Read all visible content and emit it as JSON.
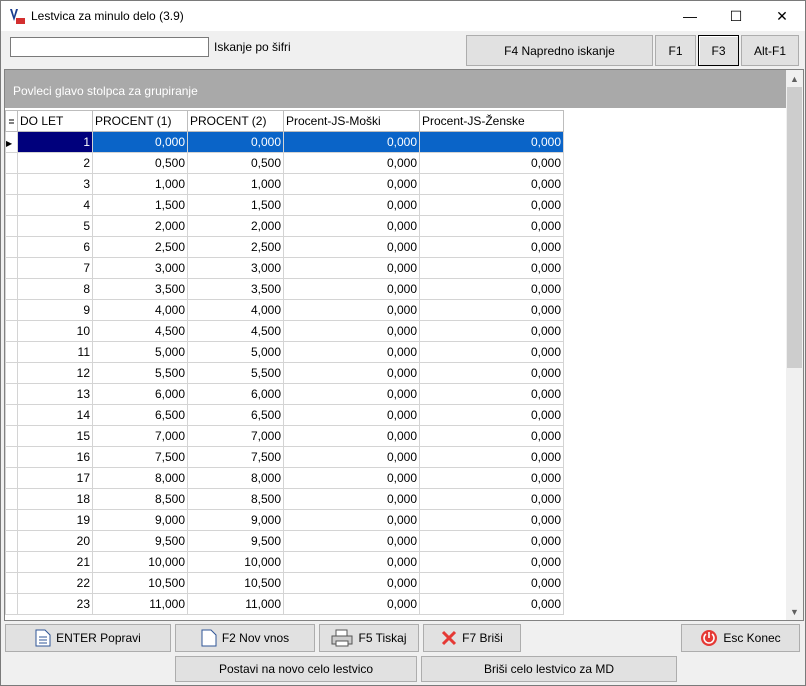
{
  "window": {
    "title": "Lestvica za minulo delo  (3.9)",
    "minimize": "—",
    "maximize": "☐",
    "close": "✕"
  },
  "toolbar": {
    "search_label": "Iskanje po šifri",
    "search_value": "",
    "advanced_search": "F4  Napredno iskanje",
    "f1": "F1",
    "f3": "F3",
    "altf1": "Alt-F1"
  },
  "grid": {
    "group_hint": "Povleci glavo stolpca za grupiranje",
    "columns": [
      "DO LET",
      "PROCENT (1)",
      "PROCENT (2)",
      "Procent-JS-Moški",
      "Procent-JS-Ženske"
    ],
    "rows": [
      [
        "1",
        "0,000",
        "0,000",
        "0,000",
        "0,000"
      ],
      [
        "2",
        "0,500",
        "0,500",
        "0,000",
        "0,000"
      ],
      [
        "3",
        "1,000",
        "1,000",
        "0,000",
        "0,000"
      ],
      [
        "4",
        "1,500",
        "1,500",
        "0,000",
        "0,000"
      ],
      [
        "5",
        "2,000",
        "2,000",
        "0,000",
        "0,000"
      ],
      [
        "6",
        "2,500",
        "2,500",
        "0,000",
        "0,000"
      ],
      [
        "7",
        "3,000",
        "3,000",
        "0,000",
        "0,000"
      ],
      [
        "8",
        "3,500",
        "3,500",
        "0,000",
        "0,000"
      ],
      [
        "9",
        "4,000",
        "4,000",
        "0,000",
        "0,000"
      ],
      [
        "10",
        "4,500",
        "4,500",
        "0,000",
        "0,000"
      ],
      [
        "11",
        "5,000",
        "5,000",
        "0,000",
        "0,000"
      ],
      [
        "12",
        "5,500",
        "5,500",
        "0,000",
        "0,000"
      ],
      [
        "13",
        "6,000",
        "6,000",
        "0,000",
        "0,000"
      ],
      [
        "14",
        "6,500",
        "6,500",
        "0,000",
        "0,000"
      ],
      [
        "15",
        "7,000",
        "7,000",
        "0,000",
        "0,000"
      ],
      [
        "16",
        "7,500",
        "7,500",
        "0,000",
        "0,000"
      ],
      [
        "17",
        "8,000",
        "8,000",
        "0,000",
        "0,000"
      ],
      [
        "18",
        "8,500",
        "8,500",
        "0,000",
        "0,000"
      ],
      [
        "19",
        "9,000",
        "9,000",
        "0,000",
        "0,000"
      ],
      [
        "20",
        "9,500",
        "9,500",
        "0,000",
        "0,000"
      ],
      [
        "21",
        "10,000",
        "10,000",
        "0,000",
        "0,000"
      ],
      [
        "22",
        "10,500",
        "10,500",
        "0,000",
        "0,000"
      ],
      [
        "23",
        "11,000",
        "11,000",
        "0,000",
        "0,000"
      ]
    ],
    "selected_row": 0
  },
  "actions": {
    "enter": "ENTER Popravi",
    "f2": "F2 Nov vnos",
    "f5": "F5 Tiskaj",
    "f7": "F7 Briši",
    "esc": "Esc Konec",
    "reset": "Postavi na novo celo lestvico",
    "delete_all": "Briši celo lestvico za MD"
  },
  "colors": {
    "selection": "#0a64c8",
    "selection_cell": "#00007c",
    "group_bar": "#a9a9a9",
    "delete_icon": "#e53935",
    "exit_icon": "#e53935"
  }
}
